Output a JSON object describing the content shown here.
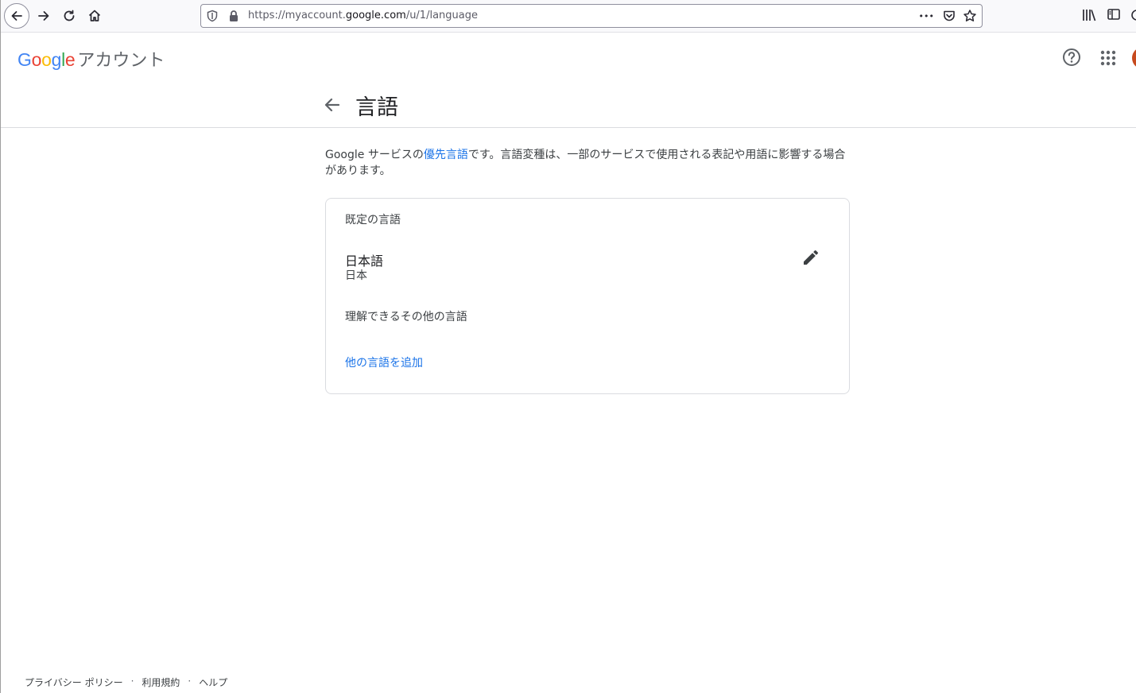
{
  "browser": {
    "url_prefix": "https://myaccount.",
    "url_domain": "google.com",
    "url_suffix": "/u/1/language",
    "more_glyph": "•••"
  },
  "header": {
    "logo_letters": [
      {
        "ch": "G",
        "color": "#4285F4"
      },
      {
        "ch": "o",
        "color": "#EA4335"
      },
      {
        "ch": "o",
        "color": "#FBBC05"
      },
      {
        "ch": "g",
        "color": "#4285F4"
      },
      {
        "ch": "l",
        "color": "#34A853"
      },
      {
        "ch": "e",
        "color": "#EA4335"
      }
    ],
    "account_label": "アカウント"
  },
  "title": {
    "text": "言語"
  },
  "description": {
    "before_link": "Google サービスの",
    "link": "優先言語",
    "after_link": "です。言語変種は、一部のサービスで使用される表記や用語に影響する場合があります。"
  },
  "card": {
    "default_label": "既定の言語",
    "language_name": "日本語",
    "language_region": "日本",
    "other_label": "理解できるその他の言語",
    "add_link": "他の言語を追加"
  },
  "footer": {
    "privacy": "プライバシー ポリシー",
    "terms": "利用規約",
    "help": "ヘルプ",
    "separator": "·"
  },
  "colors": {
    "link_blue": "#1a73e8",
    "avatar": "#c74a1e"
  }
}
